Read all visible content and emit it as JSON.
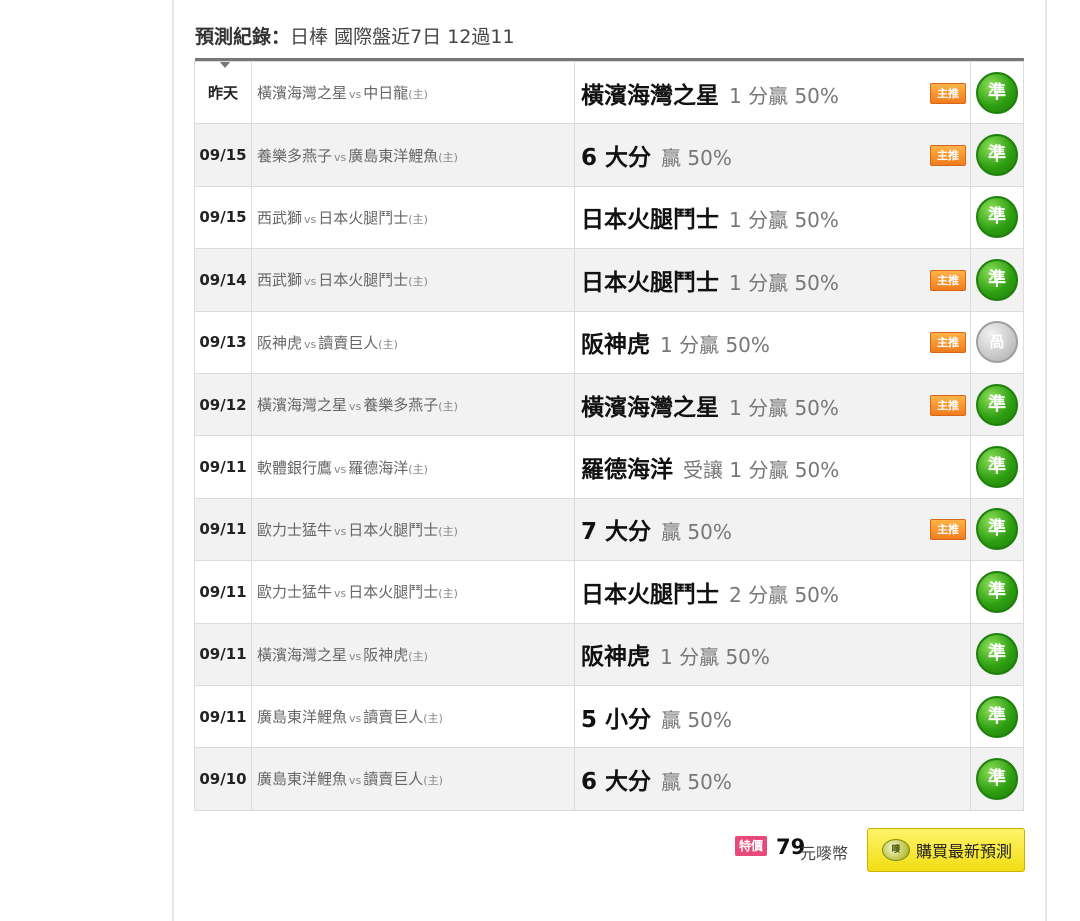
{
  "header": {
    "title_strong": "預測紀錄",
    "separator": "：",
    "summary": "日棒 國際盤近7日 12過11"
  },
  "records": [
    {
      "date": "昨天",
      "team1": "橫濱海灣之星",
      "vs": "vs",
      "team2": "中日龍",
      "home_mark": "(主)",
      "pick": "橫濱海灣之星",
      "odds": "1 分贏 50%",
      "badge": "主推",
      "result": "準",
      "result_type": "win"
    },
    {
      "date": "09/15",
      "team1": "養樂多燕子",
      "vs": "vs",
      "team2": "廣島東洋鯉魚",
      "home_mark": "(主)",
      "pick": "6 大分",
      "odds": "贏 50%",
      "badge": "主推",
      "result": "準",
      "result_type": "win"
    },
    {
      "date": "09/15",
      "team1": "西武獅",
      "vs": "vs",
      "team2": "日本火腿鬥士",
      "home_mark": "(主)",
      "pick": "日本火腿鬥士",
      "odds": "1 分贏 50%",
      "badge": "",
      "result": "準",
      "result_type": "win"
    },
    {
      "date": "09/14",
      "team1": "西武獅",
      "vs": "vs",
      "team2": "日本火腿鬥士",
      "home_mark": "(主)",
      "pick": "日本火腿鬥士",
      "odds": "1 分贏 50%",
      "badge": "主推",
      "result": "準",
      "result_type": "win"
    },
    {
      "date": "09/13",
      "team1": "阪神虎",
      "vs": "vs",
      "team2": "讀賣巨人",
      "home_mark": "(主)",
      "pick": "阪神虎",
      "odds": "1 分贏 50%",
      "badge": "主推",
      "result": "咼",
      "result_type": "void"
    },
    {
      "date": "09/12",
      "team1": "橫濱海灣之星",
      "vs": "vs",
      "team2": "養樂多燕子",
      "home_mark": "(主)",
      "pick": "橫濱海灣之星",
      "odds": "1 分贏 50%",
      "badge": "主推",
      "result": "準",
      "result_type": "win"
    },
    {
      "date": "09/11",
      "team1": "軟體銀行鷹",
      "vs": "vs",
      "team2": "羅德海洋",
      "home_mark": "(主)",
      "pick": "羅德海洋",
      "odds": "受讓 1 分贏 50%",
      "badge": "",
      "result": "準",
      "result_type": "win"
    },
    {
      "date": "09/11",
      "team1": "歐力士猛牛",
      "vs": "vs",
      "team2": "日本火腿鬥士",
      "home_mark": "(主)",
      "pick": "7 大分",
      "odds": "贏 50%",
      "badge": "主推",
      "result": "準",
      "result_type": "win"
    },
    {
      "date": "09/11",
      "team1": "歐力士猛牛",
      "vs": "vs",
      "team2": "日本火腿鬥士",
      "home_mark": "(主)",
      "pick": "日本火腿鬥士",
      "odds": "2 分贏 50%",
      "badge": "",
      "result": "準",
      "result_type": "win"
    },
    {
      "date": "09/11",
      "team1": "橫濱海灣之星",
      "vs": "vs",
      "team2": "阪神虎",
      "home_mark": "(主)",
      "pick": "阪神虎",
      "odds": "1 分贏 50%",
      "badge": "",
      "result": "準",
      "result_type": "win"
    },
    {
      "date": "09/11",
      "team1": "廣島東洋鯉魚",
      "vs": "vs",
      "team2": "讀賣巨人",
      "home_mark": "(主)",
      "pick": "5 小分",
      "odds": "贏 50%",
      "badge": "",
      "result": "準",
      "result_type": "win"
    },
    {
      "date": "09/10",
      "team1": "廣島東洋鯉魚",
      "vs": "vs",
      "team2": "讀賣巨人",
      "home_mark": "(主)",
      "pick": "6 大分",
      "odds": "贏 50%",
      "badge": "",
      "result": "準",
      "result_type": "win"
    }
  ],
  "purchase": {
    "promo_tag": "特價",
    "price": "79",
    "unit": "元嘜幣",
    "icon_text": "嘜",
    "button_label": "購買最新預測"
  },
  "colors": {
    "win": "#2fa012",
    "void": "#c8c8c8",
    "badge": "#f07c1e",
    "buy_button": "#f2de12",
    "promo": "#e8487a"
  }
}
